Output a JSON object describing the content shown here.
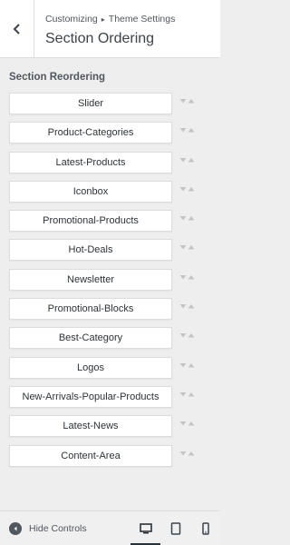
{
  "header": {
    "breadcrumb_root": "Customizing",
    "breadcrumb_parent": "Theme Settings",
    "title": "Section Ordering"
  },
  "section": {
    "label": "Section Reordering",
    "items": [
      "Slider",
      "Product-Categories",
      "Latest-Products",
      "Iconbox",
      "Promotional-Products",
      "Hot-Deals",
      "Newsletter",
      "Promotional-Blocks",
      "Best-Category",
      "Logos",
      "New-Arrivals-Popular-Products",
      "Latest-News",
      "Content-Area"
    ]
  },
  "footer": {
    "hide_controls_label": "Hide Controls",
    "devices": [
      "desktop",
      "tablet",
      "mobile"
    ],
    "active_device": "desktop"
  },
  "icons": {
    "back": "chevron-left-icon",
    "hide": "arrow-left-circle-icon",
    "reorder_up": "triangle-up-icon",
    "reorder_down": "triangle-down-icon",
    "desktop": "desktop-icon",
    "tablet": "tablet-icon",
    "mobile": "mobile-icon"
  },
  "colors": {
    "panel_bg": "#eeeeee",
    "header_bg": "#ffffff",
    "text": "#3c434a",
    "arrow": "#c3c4c7"
  }
}
